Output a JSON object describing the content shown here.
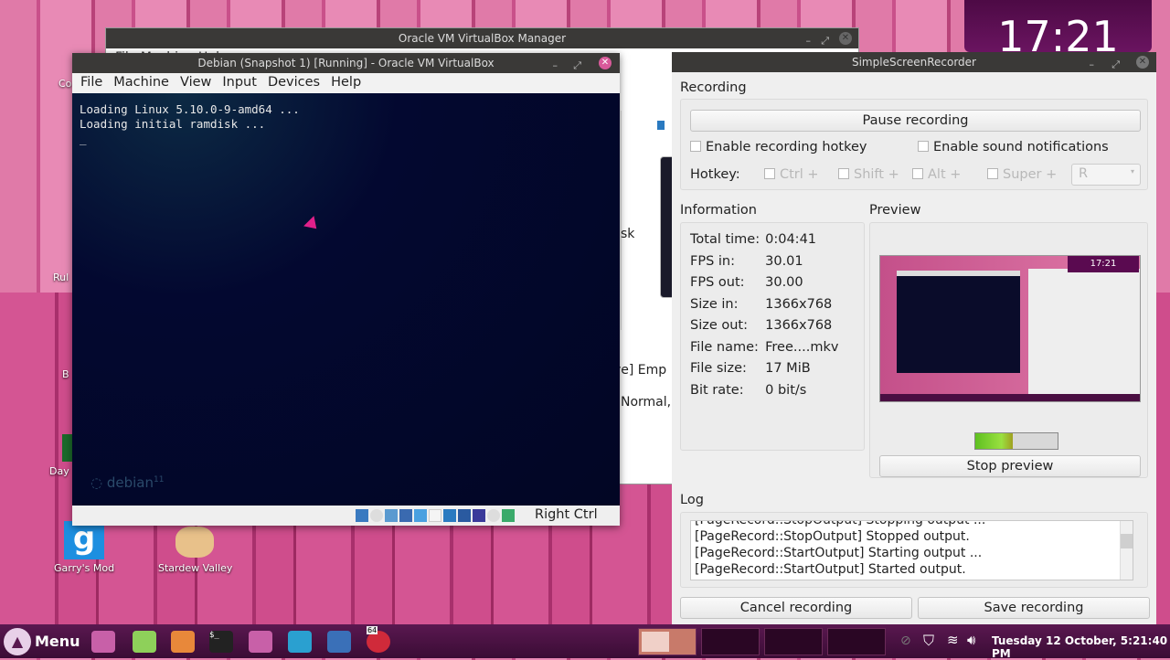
{
  "desktop": {
    "icons": [
      {
        "label": "Co"
      },
      {
        "label": "Rul"
      },
      {
        "label": "B"
      },
      {
        "label": "Day"
      },
      {
        "label": "Garry's Mod"
      },
      {
        "label": "Stardew Valley"
      }
    ],
    "clock": "17:21"
  },
  "vbox_manager": {
    "title": "Oracle VM VirtualBox Manager",
    "menu": "File  Machine  Help",
    "fragments": [
      "sk",
      "ve] Emp",
      "Normal,"
    ]
  },
  "vm_window": {
    "title": "Debian (Snapshot 1) [Running] - Oracle VM VirtualBox",
    "menu": [
      "File",
      "Machine",
      "View",
      "Input",
      "Devices",
      "Help"
    ],
    "console": [
      "Loading Linux 5.10.0-9-amd64 ...",
      "Loading initial ramdisk ...",
      "_"
    ],
    "logo": "debian",
    "logo_version": "11",
    "host_key": "Right Ctrl"
  },
  "ssr": {
    "title": "SimpleScreenRecorder",
    "recording_label": "Recording",
    "pause_button": "Pause recording",
    "enable_hotkey": "Enable recording hotkey",
    "enable_sound": "Enable sound notifications",
    "hotkey_label": "Hotkey:",
    "ctrl": "Ctrl +",
    "shift": "Shift +",
    "alt": "Alt +",
    "super": "Super +",
    "key": "R",
    "information_label": "Information",
    "preview_label": "Preview",
    "info": [
      {
        "k": "Total time:",
        "v": "0:04:41"
      },
      {
        "k": "FPS in:",
        "v": "30.01"
      },
      {
        "k": "FPS out:",
        "v": "30.00"
      },
      {
        "k": "Size in:",
        "v": "1366x768"
      },
      {
        "k": "Size out:",
        "v": "1366x768"
      },
      {
        "k": "File name:",
        "v": "Free....mkv"
      },
      {
        "k": "File size:",
        "v": "17 MiB"
      },
      {
        "k": "Bit rate:",
        "v": "0 bit/s"
      }
    ],
    "preview_clock": "17:21",
    "audio_level": 0.45,
    "stop_preview": "Stop preview",
    "log_label": "Log",
    "log": [
      "[PageRecord::StopOutput] Stopping output ...",
      "[PageRecord::StopOutput] Stopped output.",
      "[PageRecord::StartOutput] Starting output ...",
      "[PageRecord::StartOutput] Started output."
    ],
    "cancel": "Cancel recording",
    "save": "Save recording"
  },
  "taskbar": {
    "menu": "Menu",
    "datetime": "Tuesday 12 October, 5:21:40 PM",
    "badge": "64"
  }
}
